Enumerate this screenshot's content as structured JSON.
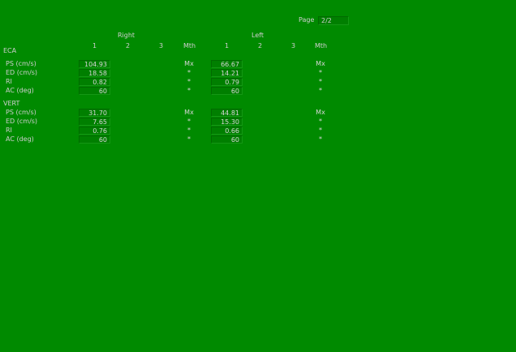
{
  "page": {
    "label": "Page",
    "value": "2/2"
  },
  "sides": {
    "right": "Right",
    "left": "Left"
  },
  "columns": {
    "c1": "1",
    "c2": "2",
    "c3": "3",
    "mth": "Mth"
  },
  "sections": [
    {
      "title": "ECA",
      "rows": [
        {
          "label": "PS (cm/s)",
          "right": "104.93",
          "right_mth": "Mx",
          "left": "66.67",
          "left_mth": "Mx"
        },
        {
          "label": "ED (cm/s)",
          "right": "18.58",
          "right_mth": "*",
          "left": "14.21",
          "left_mth": "*"
        },
        {
          "label": "RI",
          "right": "0.82",
          "right_mth": "*",
          "left": "0.79",
          "left_mth": "*"
        },
        {
          "label": "AC (deg)",
          "right": "60",
          "right_mth": "*",
          "left": "60",
          "left_mth": "*"
        }
      ]
    },
    {
      "title": "VERT",
      "rows": [
        {
          "label": "PS (cm/s)",
          "right": "31.70",
          "right_mth": "Mx",
          "left": "44.81",
          "left_mth": "Mx"
        },
        {
          "label": "ED (cm/s)",
          "right": "7.65",
          "right_mth": "*",
          "left": "15.30",
          "left_mth": "*"
        },
        {
          "label": "RI",
          "right": "0.76",
          "right_mth": "*",
          "left": "0.66",
          "left_mth": "*"
        },
        {
          "label": "AC (deg)",
          "right": "60",
          "right_mth": "*",
          "left": "60",
          "left_mth": "*"
        }
      ]
    }
  ]
}
